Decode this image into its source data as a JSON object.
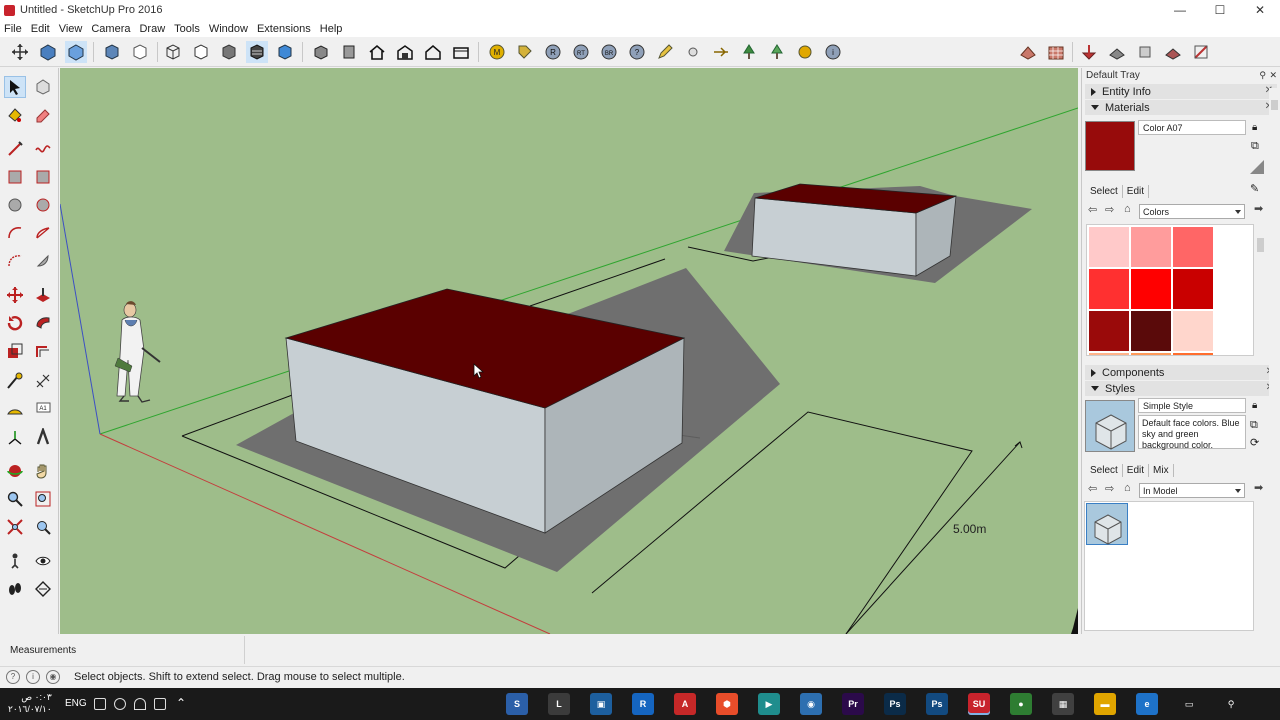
{
  "window": {
    "title": "Untitled - SketchUp Pro 2016",
    "minimize": "—",
    "maximize": "☐",
    "close": "✕"
  },
  "menu": [
    "File",
    "Edit",
    "View",
    "Camera",
    "Draw",
    "Tools",
    "Window",
    "Extensions",
    "Help"
  ],
  "viewport": {
    "dimension_label": "5.00m",
    "colors": {
      "sky_ground": "#9ebd8a",
      "roof": "#5a0000",
      "wall_light": "#c5cdd1",
      "wall_dark": "#a9b1b5",
      "shadow": "#6e6e6e"
    }
  },
  "tray": {
    "title": "Default Tray",
    "panels": {
      "entity_info": "Entity Info",
      "materials": "Materials",
      "components": "Components",
      "styles": "Styles"
    },
    "materials": {
      "current_name": "Color A07",
      "current_color": "#970b0b",
      "tabs": [
        "Select",
        "Edit"
      ],
      "library": "Colors",
      "swatches": [
        "#ffc9c9",
        "#ff9c9c",
        "#ff6666",
        "#ff3030",
        "#ff0000",
        "#c90000",
        "#9a0a0a",
        "#5a0a0a",
        "#ffd6cc",
        "#ffb38a",
        "#ff9a5a",
        "#ff6d2d"
      ]
    },
    "styles": {
      "name": "Simple Style",
      "description": "Default face colors. Blue sky and green background color.",
      "tabs": [
        "Select",
        "Edit",
        "Mix"
      ],
      "library": "In Model"
    }
  },
  "measurements": {
    "label": "Measurements"
  },
  "status": {
    "message": "Select objects. Shift to extend select. Drag mouse to select multiple."
  },
  "taskbar": {
    "time": "٠:٠٣ ص",
    "date": "٢٠١٦/٠٧/١٠",
    "language": "ENG",
    "apps": [
      {
        "name": "sketchup-s",
        "label": "S",
        "color": "#2b5fa8"
      },
      {
        "name": "layout",
        "label": "L",
        "color": "#3b3b3b"
      },
      {
        "name": "style-builder",
        "label": "▣",
        "color": "#1d5f9e"
      },
      {
        "name": "revit",
        "label": "R",
        "color": "#1565c0"
      },
      {
        "name": "autocad",
        "label": "A",
        "color": "#c62828"
      },
      {
        "name": "app-red",
        "label": "⬢",
        "color": "#e84d2a"
      },
      {
        "name": "app-teal",
        "label": "▶",
        "color": "#1f8d8d"
      },
      {
        "name": "app-globe",
        "label": "◉",
        "color": "#2d6fb0"
      },
      {
        "name": "premiere",
        "label": "Pr",
        "color": "#2b0a4a"
      },
      {
        "name": "photoshop",
        "label": "Ps",
        "color": "#0b2b48"
      },
      {
        "name": "photoshop-2",
        "label": "Ps",
        "color": "#124a80"
      },
      {
        "name": "sketchup",
        "label": "SU",
        "color": "#c8232c"
      },
      {
        "name": "chrome",
        "label": "●",
        "color": "#2e7d32"
      },
      {
        "name": "store",
        "label": "▦",
        "color": "#404040"
      },
      {
        "name": "file-explorer",
        "label": "▬",
        "color": "#e0a500"
      },
      {
        "name": "edge",
        "label": "e",
        "color": "#1e72c8"
      },
      {
        "name": "task-view",
        "label": "▭",
        "color": "#1a1a1a"
      },
      {
        "name": "search",
        "label": "⚲",
        "color": "#1a1a1a"
      }
    ]
  }
}
